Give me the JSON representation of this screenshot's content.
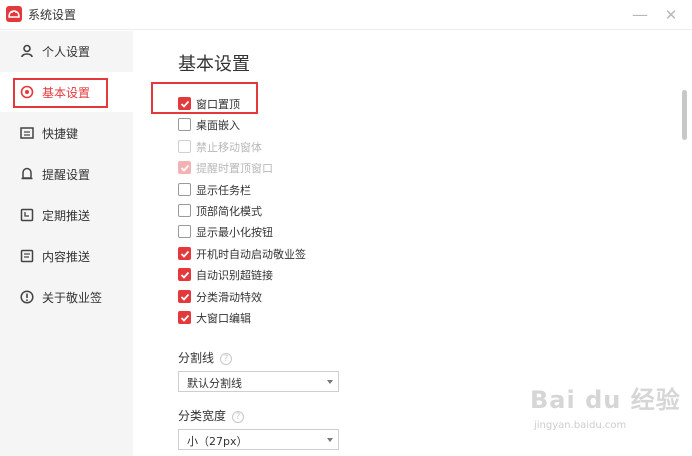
{
  "window": {
    "title": "系统设置",
    "minimize": "—",
    "close": "✕"
  },
  "sidebar": {
    "items": [
      {
        "label": "个人设置",
        "icon": "user-icon"
      },
      {
        "label": "基本设置",
        "icon": "target-icon",
        "active": true
      },
      {
        "label": "快捷键",
        "icon": "keyboard-icon"
      },
      {
        "label": "提醒设置",
        "icon": "bell-icon"
      },
      {
        "label": "定期推送",
        "icon": "clock-page-icon"
      },
      {
        "label": "内容推送",
        "icon": "document-icon"
      },
      {
        "label": "关于敬业签",
        "icon": "info-icon"
      }
    ]
  },
  "main": {
    "title": "基本设置",
    "options": [
      {
        "label": "窗口置顶",
        "checked": true,
        "disabled": false
      },
      {
        "label": "桌面嵌入",
        "checked": false,
        "disabled": false
      },
      {
        "label": "禁止移动窗体",
        "checked": false,
        "disabled": true
      },
      {
        "label": "提醒时置顶窗口",
        "checked": true,
        "disabled": true
      },
      {
        "label": "显示任务栏",
        "checked": false,
        "disabled": false
      },
      {
        "label": "顶部简化模式",
        "checked": false,
        "disabled": false
      },
      {
        "label": "显示最小化按钮",
        "checked": false,
        "disabled": false
      },
      {
        "label": "开机时自动启动敬业签",
        "checked": true,
        "disabled": false
      },
      {
        "label": "自动识别超链接",
        "checked": true,
        "disabled": false
      },
      {
        "label": "分类滑动特效",
        "checked": true,
        "disabled": false
      },
      {
        "label": "大窗口编辑",
        "checked": true,
        "disabled": false
      }
    ],
    "divider": {
      "label": "分割线",
      "help": "?",
      "value": "默认分割线"
    },
    "category_width": {
      "label": "分类宽度",
      "help": "?",
      "value": "小（27px）"
    }
  },
  "watermark": {
    "main": "Bai du 经验",
    "sub": "jingyan.baidu.com"
  },
  "colors": {
    "accent": "#e4393c",
    "sidebar_bg": "#f5f5f5"
  }
}
